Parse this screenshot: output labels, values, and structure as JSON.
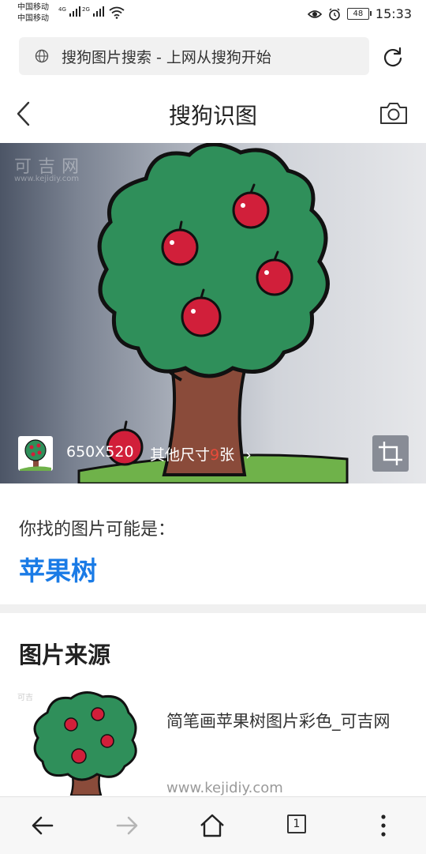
{
  "status_bar": {
    "carrier_1": "中国移动",
    "carrier_2": "中国移动",
    "net_1": "4G",
    "net_2": "2G",
    "battery": "48",
    "time": "15:33"
  },
  "url_bar": {
    "text": "搜狗图片搜索 - 上网从搜狗开始"
  },
  "title_bar": {
    "title": "搜狗识图"
  },
  "hero": {
    "dimensions": "650X520",
    "other_sizes_prefix": "其他尺寸",
    "other_sizes_count": "9",
    "other_sizes_suffix": "张",
    "chevron": "›"
  },
  "guess": {
    "label": "你找的图片可能是：",
    "result": "苹果树"
  },
  "source": {
    "heading": "图片来源",
    "items": [
      {
        "title": "简笔画苹果树图片彩色_可吉网",
        "url": "www.kejidiy.com"
      }
    ]
  },
  "bottom_nav": {
    "tab_count": "1"
  },
  "colors": {
    "link_blue": "#1a7be6",
    "count_red": "#e84a3a",
    "tree_green": "#2f8f5a",
    "apple_red": "#d11f3a",
    "trunk_brown": "#8a4b3a"
  },
  "icons": [
    "globe-icon",
    "refresh-icon",
    "back-chevron-icon",
    "camera-icon",
    "crop-icon",
    "back-arrow-icon",
    "forward-arrow-icon",
    "home-icon",
    "tabs-icon",
    "more-icon"
  ]
}
